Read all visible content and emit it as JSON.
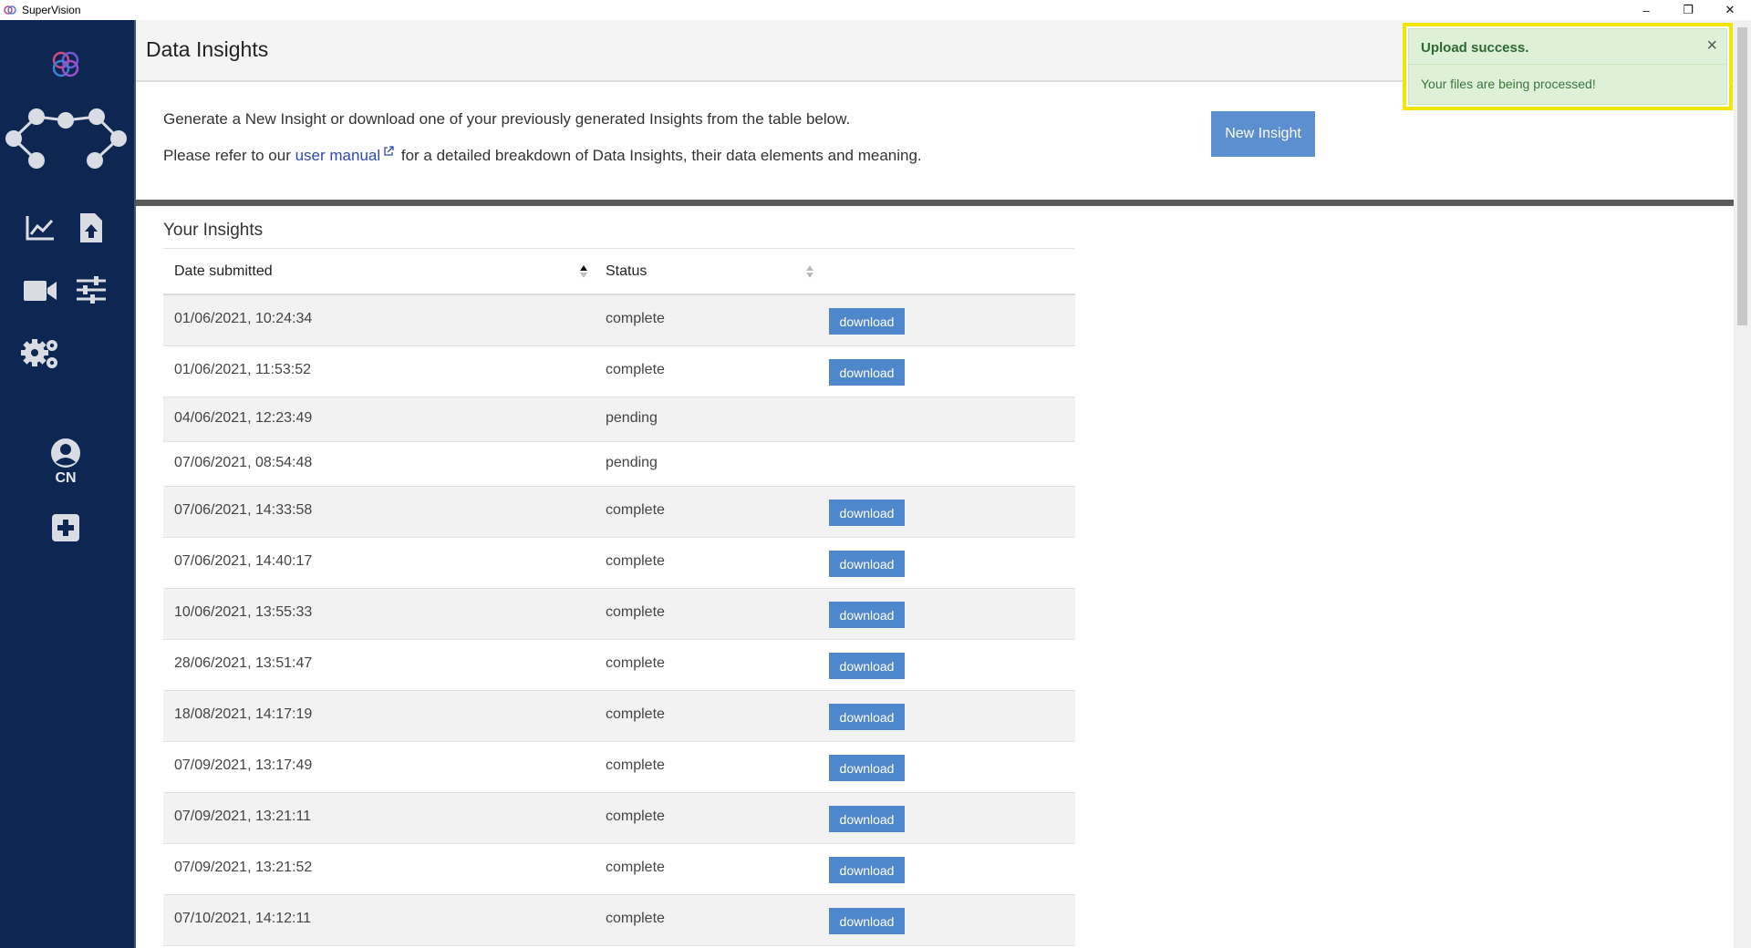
{
  "window": {
    "title": "SuperVision",
    "controls": {
      "minimize": "–",
      "restore": "❐",
      "close": "✕"
    }
  },
  "sidebar": {
    "user_initials": "CN",
    "icons": [
      "logo-icon",
      "network-icon",
      "chart-icon",
      "file-upload-icon",
      "video-icon",
      "sliders-icon",
      "gears-icon",
      "user-icon",
      "plus-square-icon"
    ]
  },
  "header": {
    "title": "Data Insights"
  },
  "intro": {
    "line1": "Generate a New Insight or download one of your previously generated Insights from the table below.",
    "line2_before": "Please refer to our ",
    "link_text": "user manual",
    "line2_after": " for a detailed breakdown of Data Insights, their data elements and meaning."
  },
  "new_insight_label": "New Insight",
  "insights": {
    "title": "Your Insights",
    "columns": {
      "date": "Date submitted",
      "status": "Status"
    },
    "download_label": "download",
    "rows": [
      {
        "date": "01/06/2021, 10:24:34",
        "status": "complete"
      },
      {
        "date": "01/06/2021, 11:53:52",
        "status": "complete"
      },
      {
        "date": "04/06/2021, 12:23:49",
        "status": "pending"
      },
      {
        "date": "07/06/2021, 08:54:48",
        "status": "pending"
      },
      {
        "date": "07/06/2021, 14:33:58",
        "status": "complete"
      },
      {
        "date": "07/06/2021, 14:40:17",
        "status": "complete"
      },
      {
        "date": "10/06/2021, 13:55:33",
        "status": "complete"
      },
      {
        "date": "28/06/2021, 13:51:47",
        "status": "complete"
      },
      {
        "date": "18/08/2021, 14:17:19",
        "status": "complete"
      },
      {
        "date": "07/09/2021, 13:17:49",
        "status": "complete"
      },
      {
        "date": "07/09/2021, 13:21:11",
        "status": "complete"
      },
      {
        "date": "07/09/2021, 13:21:52",
        "status": "complete"
      },
      {
        "date": "07/10/2021, 14:12:11",
        "status": "complete"
      }
    ]
  },
  "toast": {
    "title": "Upload success.",
    "message": "Your files are being processed!",
    "close": "×"
  },
  "colors": {
    "sidebar_bg": "#0d2652",
    "button_blue": "#5b8fcf",
    "toast_bg": "#dff0d8",
    "highlight": "#f2e600"
  }
}
